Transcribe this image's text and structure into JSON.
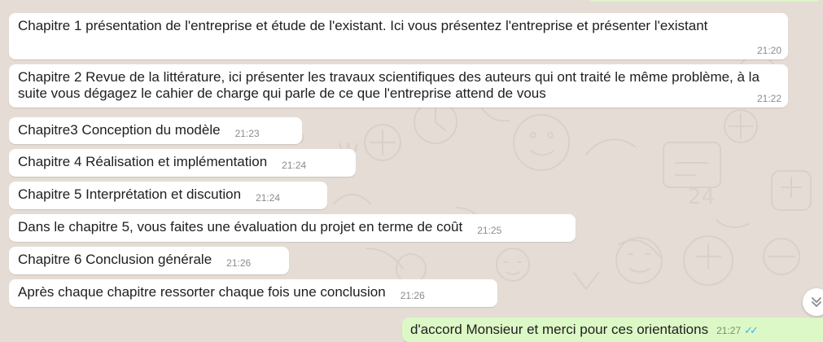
{
  "messages": [
    {
      "text": "Chapitre 1 présentation de l'entreprise et étude de l'existant. Ici vous présentez l'entreprise et présenter l'existant",
      "time": "21:20"
    },
    {
      "text": "Chapitre 2 Revue de la littérature, ici présenter les travaux scientifiques des auteurs qui ont traité le même problème, à la suite vous dégagez le cahier de charge qui parle de ce que l'entreprise attend de vous",
      "time": "21:22"
    },
    {
      "text": "Chapitre3 Conception du modèle",
      "time": "21:23"
    },
    {
      "text": "Chapitre 4 Réalisation et implémentation",
      "time": "21:24"
    },
    {
      "text": "Chapitre 5 Interprétation et discution",
      "time": "21:24"
    },
    {
      "text": "Dans le chapitre 5, vous faites une évaluation du projet en terme de coût",
      "time": "21:25"
    },
    {
      "text": "Chapitre 6 Conclusion générale",
      "time": "21:26"
    },
    {
      "text": "Après chaque chapitre  ressorter chaque fois une conclusion",
      "time": "21:26"
    }
  ],
  "outgoing": {
    "text": "d'accord Monsieur et merci pour ces orientations",
    "time": "21:27"
  },
  "icons": {
    "scroll_down": "double-chevron-down-icon",
    "read_receipt": "double-check-icon"
  },
  "colors": {
    "background": "#e5ddd5",
    "incoming_bubble": "#ffffff",
    "outgoing_bubble": "#dcf8c6",
    "timestamp": "#8c8c8c",
    "read_tick": "#34b7f1"
  }
}
